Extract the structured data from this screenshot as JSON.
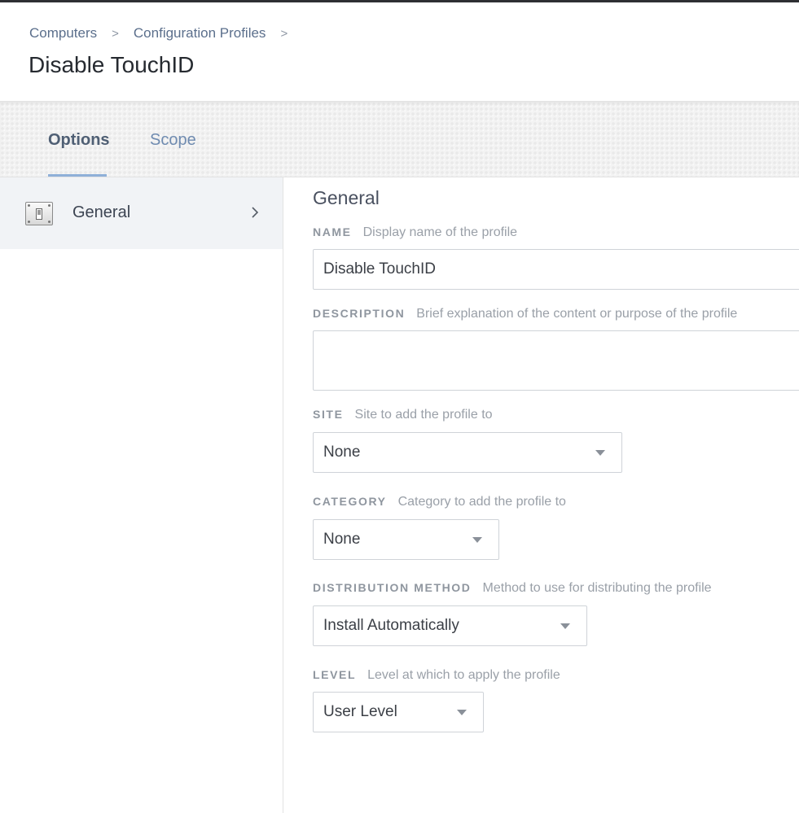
{
  "breadcrumb": {
    "items": [
      "Computers",
      "Configuration Profiles"
    ],
    "separator": ">"
  },
  "page": {
    "title": "Disable TouchID"
  },
  "tabs": [
    {
      "label": "Options",
      "active": true
    },
    {
      "label": "Scope",
      "active": false
    }
  ],
  "sidebar": {
    "items": [
      {
        "label": "General",
        "icon": "switch-panel-icon",
        "selected": true
      }
    ]
  },
  "form": {
    "section_title": "General",
    "name": {
      "label": "NAME",
      "hint": "Display name of the profile",
      "value": "Disable TouchID"
    },
    "description": {
      "label": "DESCRIPTION",
      "hint": "Brief explanation of the content or purpose of the profile",
      "value": ""
    },
    "site": {
      "label": "SITE",
      "hint": "Site to add the profile to",
      "value": "None"
    },
    "category": {
      "label": "CATEGORY",
      "hint": "Category to add the profile to",
      "value": "None"
    },
    "distribution": {
      "label": "DISTRIBUTION METHOD",
      "hint": "Method to use for distributing the profile",
      "value": "Install Automatically"
    },
    "level": {
      "label": "LEVEL",
      "hint": "Level at which to apply the profile",
      "value": "User Level"
    }
  },
  "colors": {
    "accent_tab_underline": "#8fb0d8",
    "link": "#5b6f8c",
    "sidebar_selected_bg": "#f1f3f6"
  }
}
